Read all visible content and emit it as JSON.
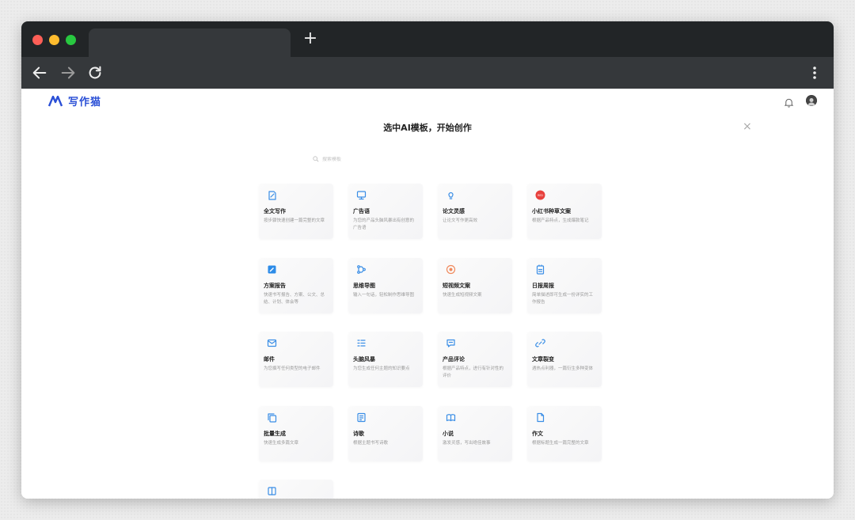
{
  "browser": {
    "new_tab_symbol": "+"
  },
  "app": {
    "logo_text": "写作猫",
    "dialog_title": "选中AI模板，开始创作",
    "close_symbol": "×",
    "search": {
      "placeholder": "搜索模板"
    }
  },
  "templates": [
    {
      "title": "全文写作",
      "desc": "按步骤快速创建一篇完整的文章",
      "icon": "edit-doc-icon",
      "color": "#3a8ee6"
    },
    {
      "title": "广告语",
      "desc": "为您的产品头脑风暴出有创意的广告语",
      "icon": "monitor-icon",
      "color": "#3a8ee6"
    },
    {
      "title": "论文灵感",
      "desc": "让论文写作更高效",
      "icon": "bulb-icon",
      "color": "#3a8ee6"
    },
    {
      "title": "小红书种草文案",
      "desc": "根据产品特点，生成爆款笔记",
      "icon": "xiaohongshu-icon",
      "color": "#e8413d"
    },
    {
      "title": "方案报告",
      "desc": "快速书写报告、方案、公文、总结、计划、体会等",
      "icon": "pencil-square-icon",
      "color": "#2d8ce8"
    },
    {
      "title": "思维导图",
      "desc": "输入一句话，轻松制作思维导图",
      "icon": "mindmap-icon",
      "color": "#3a8ee6"
    },
    {
      "title": "短视频文案",
      "desc": "快速生成短视频文案",
      "icon": "video-circle-icon",
      "color": "#f08a5d"
    },
    {
      "title": "日报周报",
      "desc": "简单描述即可生成一份详实的工作报告",
      "icon": "report-icon",
      "color": "#3a8ee6"
    },
    {
      "title": "邮件",
      "desc": "为您撰写任何类型的电子邮件",
      "icon": "mail-icon",
      "color": "#3a8ee6"
    },
    {
      "title": "头脑风暴",
      "desc": "为您生成任何主题的知识要点",
      "icon": "list-icon",
      "color": "#3a8ee6"
    },
    {
      "title": "产品评论",
      "desc": "根据产品特点，进行有针对性的评价",
      "icon": "comment-icon",
      "color": "#3a8ee6"
    },
    {
      "title": "文章裂变",
      "desc": "遇热点利器，一篇衍生多种变体",
      "icon": "link-icon",
      "color": "#3a8ee6"
    },
    {
      "title": "批量生成",
      "desc": "快速生成多篇文章",
      "icon": "copy-stack-icon",
      "color": "#3a8ee6"
    },
    {
      "title": "诗歌",
      "desc": "根据主题书写诗歌",
      "icon": "book-list-icon",
      "color": "#3a8ee6"
    },
    {
      "title": "小说",
      "desc": "激发灵感，写出绝佳故事",
      "icon": "open-book-icon",
      "color": "#3a8ee6"
    },
    {
      "title": "作文",
      "desc": "根据标题生成一篇完整的文章",
      "icon": "file-icon",
      "color": "#3a8ee6"
    },
    {
      "title": "",
      "desc": "",
      "icon": "book-icon",
      "color": "#3a8ee6"
    }
  ]
}
